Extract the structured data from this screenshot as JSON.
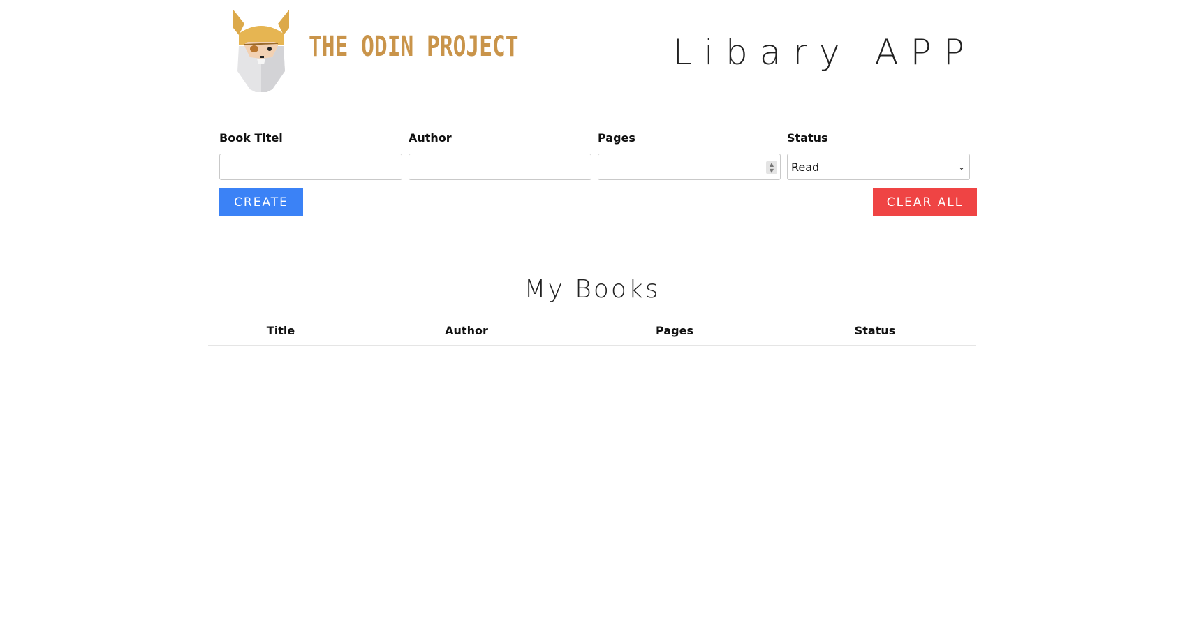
{
  "header": {
    "logo_text": "THE ODIN PROJECT",
    "title": "Libary APP"
  },
  "form": {
    "fields": [
      {
        "label": "Book Titel",
        "value": ""
      },
      {
        "label": "Author",
        "value": ""
      },
      {
        "label": "Pages",
        "value": ""
      },
      {
        "label": "Status",
        "value": "Read"
      }
    ],
    "create_label": "CREATE",
    "clear_label": "CLEAR ALL"
  },
  "books": {
    "title": "My Books",
    "columns": [
      "Title",
      "Author",
      "Pages",
      "Status"
    ]
  },
  "colors": {
    "create": "#3b82f6",
    "clear": "#ef4444",
    "logo": "#c9944a"
  }
}
